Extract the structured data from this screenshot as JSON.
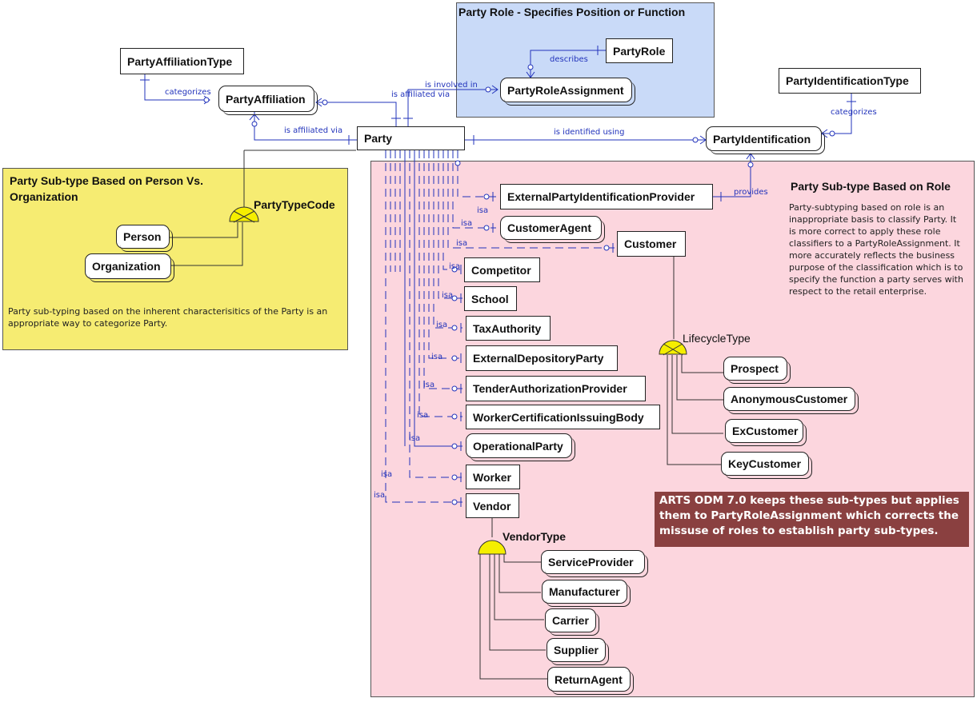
{
  "regions": {
    "party_role": {
      "title": "Party Role - Specifies Position or Function"
    },
    "person_org": {
      "title": "Party Sub-type Based on Person Vs. Organization",
      "note": "Party sub-typing based on the inherent characterisitics of the Party is an appropriate way to categorize Party."
    },
    "role": {
      "title": "Party Sub-type Based on Role",
      "note": "Party-subtyping based on role is an inappropriate basis to classify Party. It is more correct to apply these role classifiers to a PartyRoleAssignment. It more accurately reflects the business purpose of the classification which is to specify the function a party serves with respect to the retail enterprise.",
      "callout": "ARTS ODM 7.0 keeps these sub-types but applies them to PartyRoleAssignment which corrects the missuse of roles to establish party sub-types."
    }
  },
  "entities": {
    "party": "Party",
    "party_affiliation_type": "PartyAffiliationType",
    "party_affiliation": "PartyAffiliation",
    "party_role": "PartyRole",
    "party_role_assignment": "PartyRoleAssignment",
    "party_identification_type": "PartyIdentificationType",
    "party_identification": "PartyIdentification",
    "person": "Person",
    "organization": "Organization",
    "external_party_identification_provider": "ExternalPartyIdentificationProvider",
    "customer_agent": "CustomerAgent",
    "customer": "Customer",
    "competitor": "Competitor",
    "school": "School",
    "tax_authority": "TaxAuthority",
    "external_depository_party": "ExternalDepositoryParty",
    "tender_authorization_provider": "TenderAuthorizationProvider",
    "worker_certification_issuing_body": "WorkerCertificationIssuingBody",
    "operational_party": "OperationalParty",
    "worker": "Worker",
    "vendor": "Vendor",
    "prospect": "Prospect",
    "anonymous_customer": "AnonymousCustomer",
    "ex_customer": "ExCustomer",
    "key_customer": "KeyCustomer",
    "service_provider": "ServiceProvider",
    "manufacturer": "Manufacturer",
    "carrier": "Carrier",
    "supplier": "Supplier",
    "return_agent": "ReturnAgent"
  },
  "categories": {
    "party_type_code": "PartyTypeCode",
    "lifecycle_type": "LifecycleType",
    "vendor_type": "VendorType"
  },
  "relationships": {
    "categorizes_affiliation": "categorizes",
    "is_affiliated_via_1": "is affiliated via",
    "is_affiliated_via_2": "is affiliated via",
    "is_involved_in": "is involved in",
    "describes": "describes",
    "is_identified_using": "is identified using",
    "categorizes_identification": "categorizes",
    "provides": "provides",
    "isa": "isa"
  },
  "colors": {
    "role_region": "#c9daf8",
    "person_org_region": "#f6ec72",
    "subtype_region": "#fcd6de",
    "callout": "#8a4040",
    "line": "#2233bb",
    "discriminator": "#f5ee00"
  }
}
